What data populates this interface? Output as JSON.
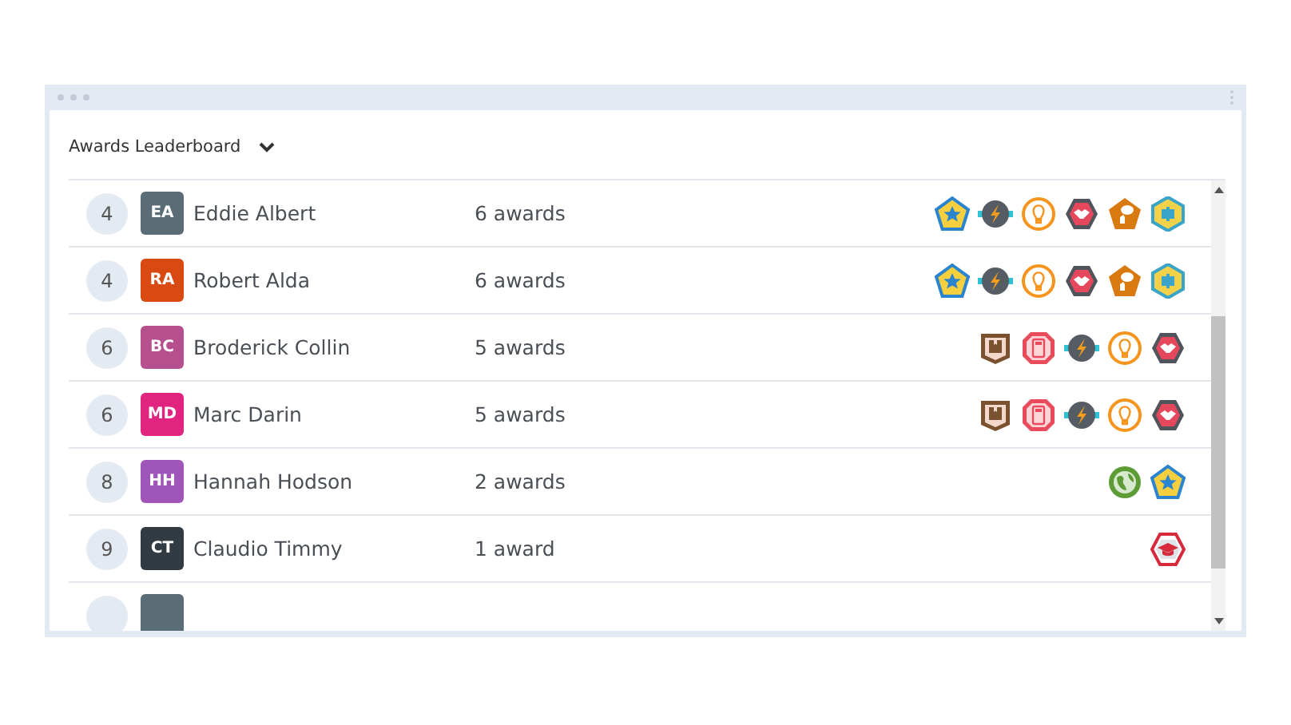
{
  "widget": {
    "title": "Awards Leaderboard"
  },
  "rows": [
    {
      "rank": "4",
      "initials": "EA",
      "color": "#5a6d77",
      "name": "Eddie Albert",
      "awards": "6 awards",
      "badges": [
        {
          "kind": "star"
        },
        {
          "kind": "bolt"
        },
        {
          "kind": "bulb"
        },
        {
          "kind": "handshake"
        },
        {
          "kind": "speech"
        },
        {
          "kind": "puzzle"
        }
      ]
    },
    {
      "rank": "4",
      "initials": "RA",
      "color": "#d84a12",
      "name": "Robert Alda",
      "awards": "6 awards",
      "badges": [
        {
          "kind": "star"
        },
        {
          "kind": "bolt"
        },
        {
          "kind": "bulb"
        },
        {
          "kind": "handshake"
        },
        {
          "kind": "speech"
        },
        {
          "kind": "puzzle"
        }
      ]
    },
    {
      "rank": "6",
      "initials": "BC",
      "color": "#b64f8e",
      "name": "Broderick Collin",
      "awards": "5 awards",
      "badges": [
        {
          "kind": "book"
        },
        {
          "kind": "calculator"
        },
        {
          "kind": "bolt"
        },
        {
          "kind": "bulb"
        },
        {
          "kind": "handshake"
        }
      ]
    },
    {
      "rank": "6",
      "initials": "MD",
      "color": "#e0247f",
      "name": "Marc Darin",
      "awards": "5 awards",
      "badges": [
        {
          "kind": "book"
        },
        {
          "kind": "calculator"
        },
        {
          "kind": "bolt"
        },
        {
          "kind": "bulb"
        },
        {
          "kind": "handshake"
        }
      ]
    },
    {
      "rank": "8",
      "initials": "HH",
      "color": "#a055b8",
      "name": "Hannah Hodson",
      "awards": "2 awards",
      "badges": [
        {
          "kind": "globe"
        },
        {
          "kind": "star"
        }
      ]
    },
    {
      "rank": "9",
      "initials": "CT",
      "color": "#323a42",
      "name": "Claudio Timmy",
      "awards": "1 award",
      "badges": [
        {
          "kind": "cap"
        }
      ]
    },
    {
      "color": "#5a6d77",
      "badges": []
    }
  ]
}
